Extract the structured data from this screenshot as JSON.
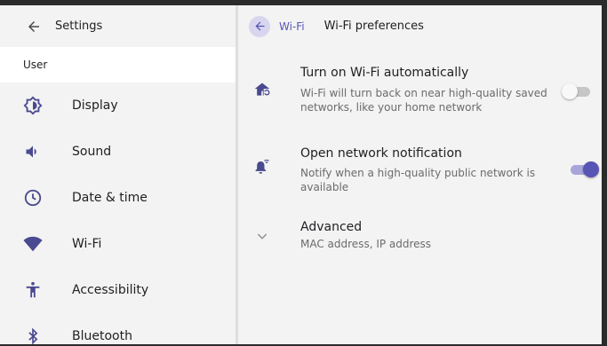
{
  "left_pane": {
    "title": "Settings",
    "user_label": "User",
    "items": [
      {
        "label": "Display",
        "icon": "display-icon"
      },
      {
        "label": "Sound",
        "icon": "volume-icon"
      },
      {
        "label": "Date & time",
        "icon": "clock-icon"
      },
      {
        "label": "Wi-Fi",
        "icon": "wifi-icon"
      },
      {
        "label": "Accessibility",
        "icon": "accessibility-icon"
      },
      {
        "label": "Bluetooth",
        "icon": "bluetooth-icon"
      }
    ]
  },
  "right_pane": {
    "breadcrumb": "Wi-Fi",
    "title": "Wi-Fi preferences",
    "preferences": [
      {
        "title": "Turn on Wi-Fi automatically",
        "summary": "Wi-Fi will turn back on near high-quality saved networks, like your home network",
        "enabled": false,
        "icon": "home-wifi-auto-icon"
      },
      {
        "title": "Open network notification",
        "summary": "Notify when a high-quality public network is available",
        "enabled": true,
        "icon": "notification-wifi-icon"
      },
      {
        "title": "Advanced",
        "summary": "MAC address, IP address",
        "icon": "chevron-down-icon"
      }
    ]
  },
  "colors": {
    "accent": "#5654b5",
    "accent_light": "#a7a5da",
    "background": "#f3f3f3",
    "selected_row": "#ffffff"
  }
}
